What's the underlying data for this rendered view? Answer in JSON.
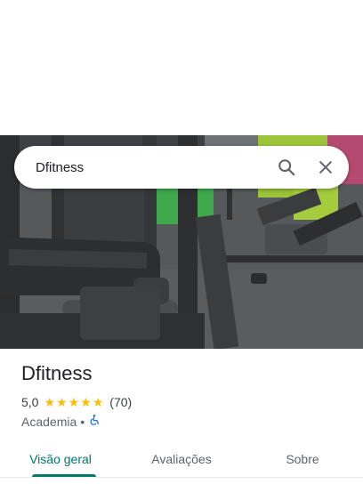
{
  "search": {
    "query": "Dfitness",
    "search_icon": "search-icon",
    "close_icon": "close-icon"
  },
  "place": {
    "title": "Dfitness",
    "rating": "5,0",
    "stars": 5,
    "review_count": "(70)",
    "category": "Academia",
    "separator": "•",
    "accessibility_icon": "wheelchair-icon"
  },
  "tabs": [
    {
      "label": "Visão geral",
      "active": true
    },
    {
      "label": "Avaliações",
      "active": false
    },
    {
      "label": "Sobre",
      "active": false
    }
  ],
  "colors": {
    "accent": "#00796b",
    "star": "#fbbc04",
    "accessibility": "#1a73e8"
  }
}
